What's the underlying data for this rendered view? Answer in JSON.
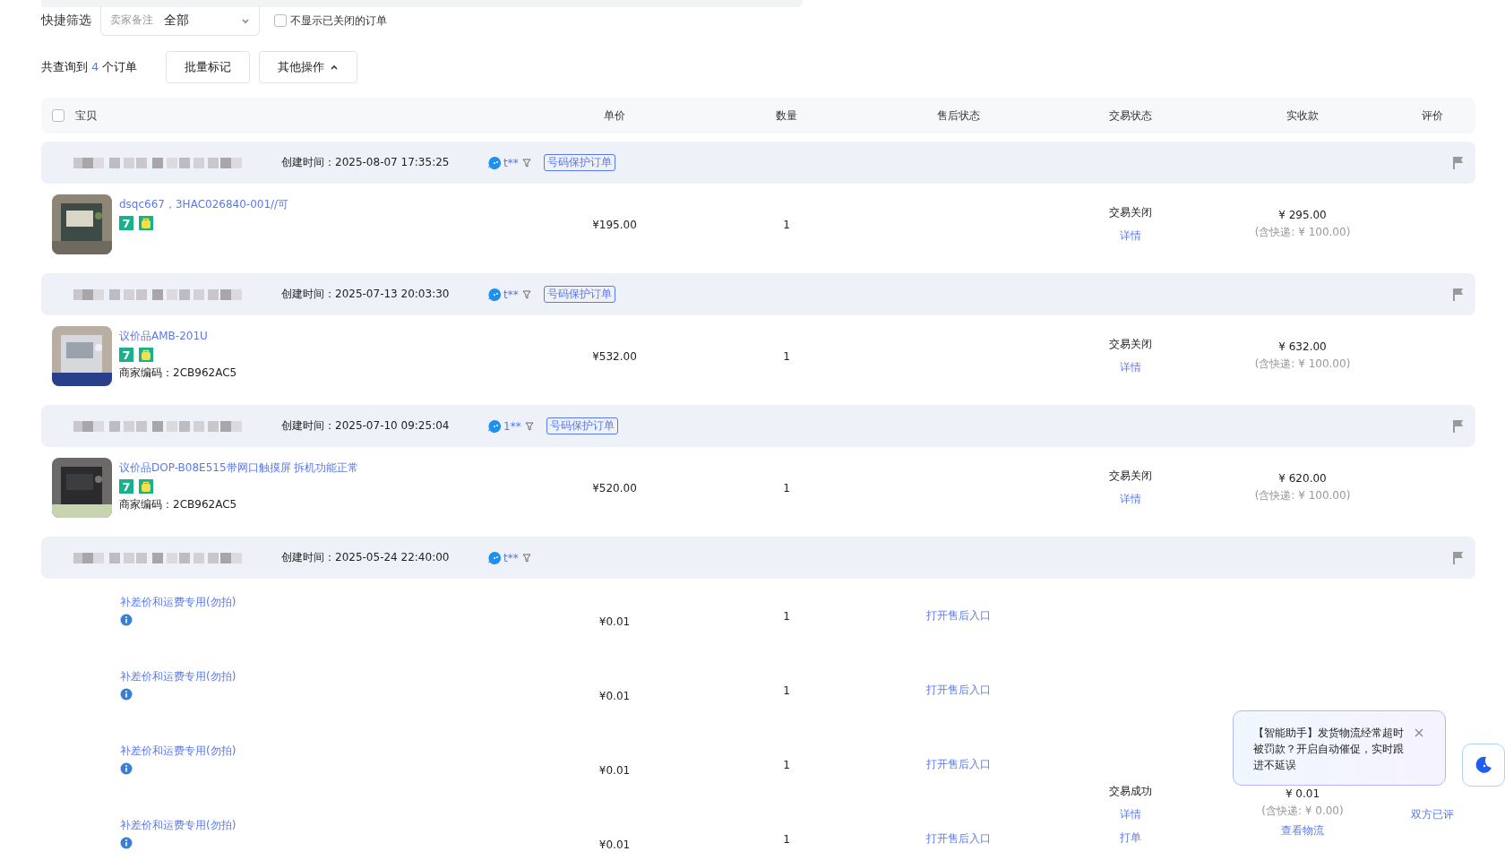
{
  "filter": {
    "label": "快捷筛选",
    "remark_select": {
      "label": "卖家备注",
      "value": "全部"
    },
    "hide_closed": {
      "label": "不显示已关闭的订单",
      "checked": false
    }
  },
  "summary": {
    "prefix": "共查询到",
    "count": "4",
    "suffix": "个订单"
  },
  "buttons": [
    {
      "label": "批量标记",
      "kind": "plain"
    },
    {
      "label": "其他操作",
      "kind": "dropdown"
    }
  ],
  "table": {
    "select_all": {
      "checked": false
    },
    "columns": [
      "宝贝",
      "单价",
      "数量",
      "售后状态",
      "交易状态",
      "实收款",
      "评价"
    ]
  },
  "orders": [
    {
      "created_label": "创建时间：",
      "created": "2025-08-07 17:35:25",
      "buyer": "t**",
      "tag": "号码保护订单",
      "status": "交易关闭",
      "status_links": [
        "详情"
      ],
      "total": "¥ 295.00",
      "shipping": "(含快递: ¥ 100.00)",
      "items": [
        {
          "kind": "product",
          "title": "dsqc667，3HAC026840-001//可",
          "badge": "7",
          "price": "¥195.00",
          "qty": "1"
        }
      ]
    },
    {
      "created_label": "创建时间：",
      "created": "2025-07-13 20:03:30",
      "buyer": "t**",
      "tag": "号码保护订单",
      "status": "交易关闭",
      "status_links": [
        "详情"
      ],
      "total": "¥ 632.00",
      "shipping": "(含快递: ¥ 100.00)",
      "items": [
        {
          "kind": "product",
          "title": "议价品AMB-201U",
          "badge": "7",
          "code": "商家编码：2CB962AC5",
          "price": "¥532.00",
          "qty": "1"
        }
      ]
    },
    {
      "created_label": "创建时间：",
      "created": "2025-07-10 09:25:04",
      "buyer": "1**",
      "tag": "号码保护订单",
      "status": "交易关闭",
      "status_links": [
        "详情"
      ],
      "total": "¥ 620.00",
      "shipping": "(含快递: ¥ 100.00)",
      "items": [
        {
          "kind": "product",
          "title": "议价品DOP-B08E515带网口触摸屏 拆机功能正常",
          "badge": "7",
          "code": "商家编码：2CB962AC5",
          "price": "¥520.00",
          "qty": "1"
        }
      ]
    },
    {
      "created_label": "创建时间：",
      "created": "2025-05-24 22:40:00",
      "buyer": "t**",
      "status": "交易成功",
      "status_links": [
        "详情",
        "打单"
      ],
      "total": "¥ 0.01",
      "shipping": "(含快递: ¥ 0.00)",
      "total_links": [
        "查看物流"
      ],
      "review": "双方已评",
      "items": [
        {
          "kind": "fee",
          "title": "补差价和运费专用(勿拍)",
          "price": "¥0.01",
          "qty": "1",
          "after_sale": "打开售后入口"
        },
        {
          "kind": "fee",
          "title": "补差价和运费专用(勿拍)",
          "price": "¥0.01",
          "qty": "1",
          "after_sale": "打开售后入口"
        },
        {
          "kind": "fee",
          "title": "补差价和运费专用(勿拍)",
          "price": "¥0.01",
          "qty": "1",
          "after_sale": "打开售后入口"
        },
        {
          "kind": "fee",
          "title": "补差价和运费专用(勿拍)",
          "price": "¥0.01",
          "qty": "1",
          "after_sale": "打开售后入口"
        }
      ]
    }
  ],
  "assistant_popup": {
    "text": "【智能助手】发货物流经常超时被罚款？开启自动催促，实时跟进不延误"
  }
}
